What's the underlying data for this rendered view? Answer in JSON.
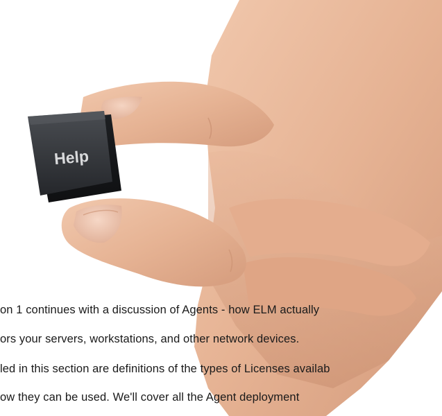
{
  "photo": {
    "subject_icon": "hand-holding-key-icon",
    "key_label": "Help",
    "colors": {
      "key": "#2e3034",
      "key_text": "#d9dadc",
      "skin": "#e8b89b",
      "background": "#ffffff"
    }
  },
  "body_text": {
    "lines": [
      "on 1 continues with a discussion of Agents - how ELM actually",
      "ors your servers, workstations, and other network devices.",
      "led in this section are definitions of the types of Licenses availab",
      "ow they can be used. We'll cover all the Agent deployment"
    ]
  }
}
